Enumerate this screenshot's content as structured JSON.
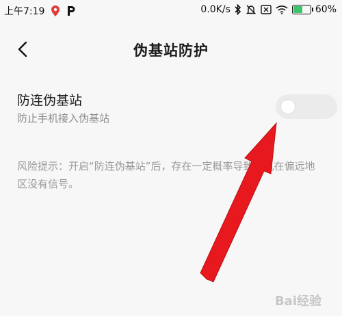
{
  "status_bar": {
    "time": "上午7:19",
    "network_speed": "0.0K/s",
    "battery_percent": "60%",
    "battery_level": 0.6,
    "icons": [
      "location-pin-icon",
      "parking-p-icon",
      "bluetooth-icon",
      "mute-bell-icon",
      "sim-x-icon",
      "wifi-icon",
      "battery-charging-icon"
    ]
  },
  "header": {
    "title": "伪基站防护",
    "back_icon": "chevron-left-icon"
  },
  "setting": {
    "title": "防连伪基站",
    "subtitle": "防止手机接入伪基站",
    "enabled": false
  },
  "risk_note": "风险提示：开启“防连伪基站”后，存在一定概率导致手机在偏远地区没有信号。",
  "watermark": "Bai经验",
  "colors": {
    "background": "#f7f7f7",
    "toggle_off": "#ebebeb",
    "arrow": "#e8191e",
    "battery_fill": "#3cc46b"
  }
}
